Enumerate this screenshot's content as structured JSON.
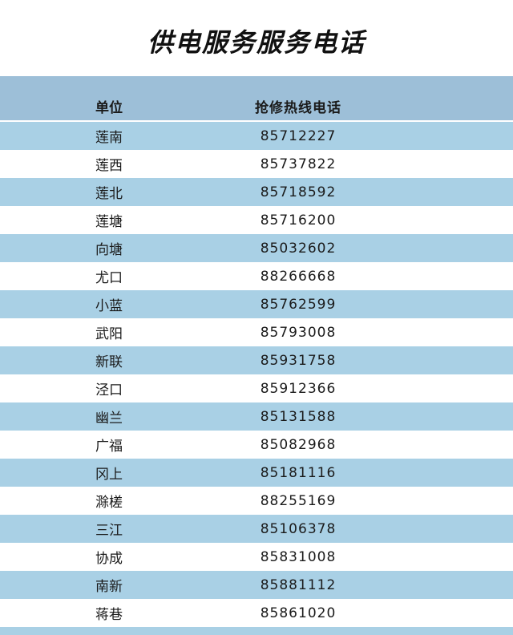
{
  "title": "供电服务服务电话",
  "table": {
    "headers": [
      "单位",
      "抢修热线电话"
    ],
    "rows": [
      {
        "unit": "莲南",
        "phone": "85712227"
      },
      {
        "unit": "莲西",
        "phone": "85737822"
      },
      {
        "unit": "莲北",
        "phone": "85718592"
      },
      {
        "unit": "莲塘",
        "phone": "85716200"
      },
      {
        "unit": "向塘",
        "phone": "85032602"
      },
      {
        "unit": "尤口",
        "phone": "88266668"
      },
      {
        "unit": "小蓝",
        "phone": "85762599"
      },
      {
        "unit": "武阳",
        "phone": "85793008"
      },
      {
        "unit": "新联",
        "phone": "85931758"
      },
      {
        "unit": "泾口",
        "phone": "85912366"
      },
      {
        "unit": "幽兰",
        "phone": "85131588"
      },
      {
        "unit": "广福",
        "phone": "85082968"
      },
      {
        "unit": "冈上",
        "phone": "85181116"
      },
      {
        "unit": "滁槎",
        "phone": "88255169"
      },
      {
        "unit": "三江",
        "phone": "85106378"
      },
      {
        "unit": "协成",
        "phone": "85831008"
      },
      {
        "unit": "南新",
        "phone": "85881112"
      },
      {
        "unit": "蒋巷",
        "phone": "85861020"
      }
    ]
  },
  "colors": {
    "header_bg": "#9dbfd8",
    "stripe_bg": "#a9d0e5",
    "plain_bg": "#ffffff"
  }
}
